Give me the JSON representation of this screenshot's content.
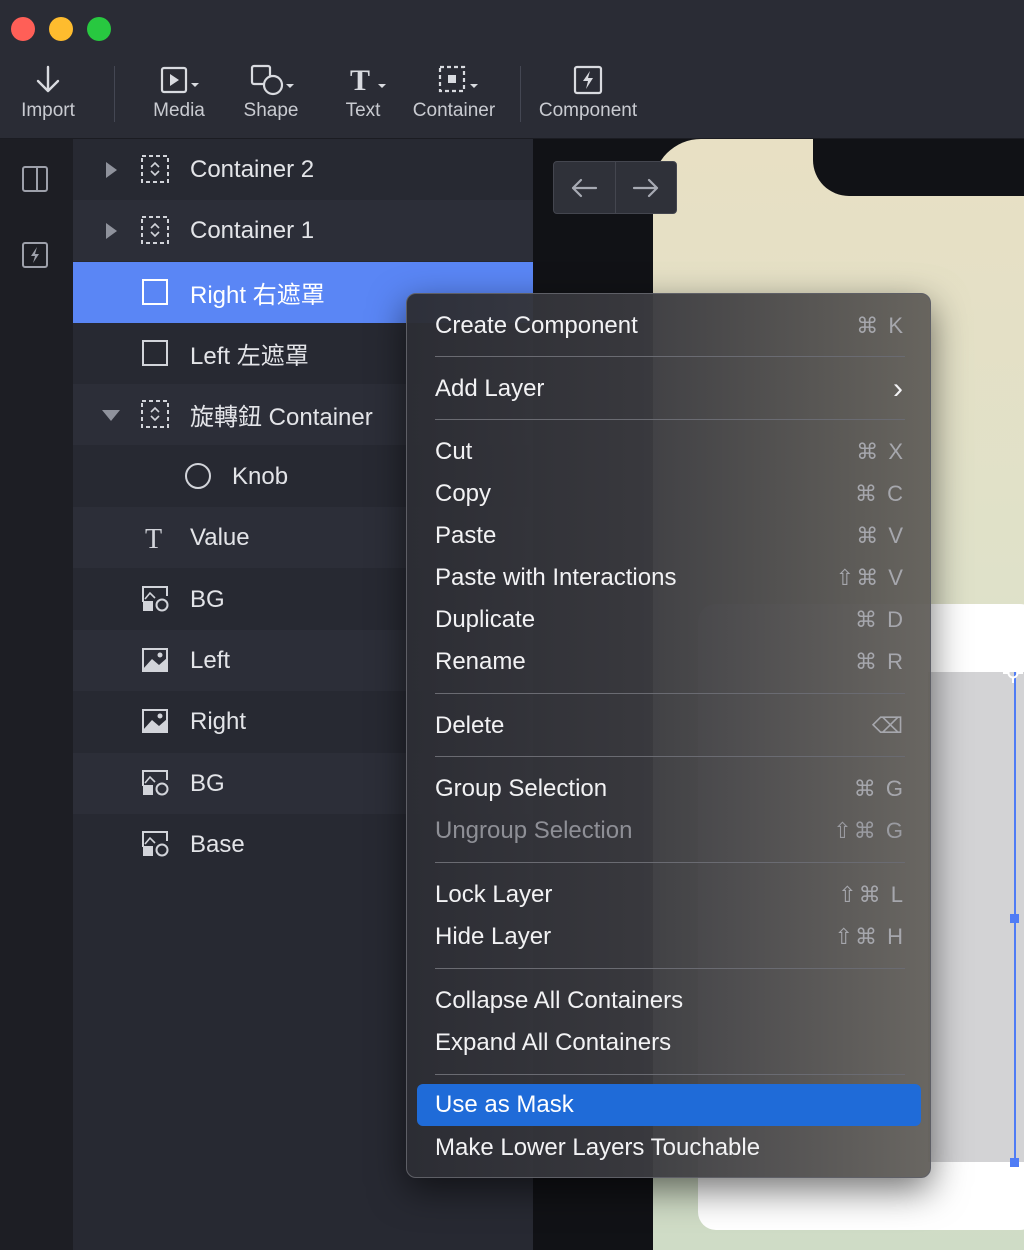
{
  "toolbar": {
    "import": "Import",
    "media": "Media",
    "shape": "Shape",
    "text": "Text",
    "container": "Container",
    "component": "Component"
  },
  "layers": [
    {
      "label": "Container 2",
      "icon": "container-icon",
      "expander": "collapsed"
    },
    {
      "label": "Container 1",
      "icon": "container-icon",
      "expander": "collapsed"
    },
    {
      "label": "Right 右遮罩",
      "icon": "rectangle-icon",
      "selected": true
    },
    {
      "label": "Left 左遮罩",
      "icon": "rectangle-icon"
    },
    {
      "label": "旋轉鈕 Container",
      "icon": "container-icon",
      "expander": "expanded"
    },
    {
      "label": "Knob",
      "icon": "circle-icon"
    },
    {
      "label": "Value",
      "icon": "text-icon"
    },
    {
      "label": "BG",
      "icon": "image-shape-icon"
    },
    {
      "label": "Left",
      "icon": "image-icon"
    },
    {
      "label": "Right",
      "icon": "image-icon"
    },
    {
      "label": "BG",
      "icon": "image-shape-icon"
    },
    {
      "label": "Base",
      "icon": "image-shape-icon"
    }
  ],
  "menu": {
    "create_component": {
      "label": "Create Component",
      "shortcut": "⌘ K"
    },
    "add_layer": {
      "label": "Add Layer",
      "shortcut": "›"
    },
    "cut": {
      "label": "Cut",
      "shortcut": "⌘ X"
    },
    "copy": {
      "label": "Copy",
      "shortcut": "⌘ C"
    },
    "paste": {
      "label": "Paste",
      "shortcut": "⌘ V"
    },
    "paste_interactions": {
      "label": "Paste with Interactions",
      "shortcut": "⇧⌘ V"
    },
    "duplicate": {
      "label": "Duplicate",
      "shortcut": "⌘ D"
    },
    "rename": {
      "label": "Rename",
      "shortcut": "⌘ R"
    },
    "delete": {
      "label": "Delete",
      "shortcut": "⌫"
    },
    "group": {
      "label": "Group Selection",
      "shortcut": "⌘ G"
    },
    "ungroup": {
      "label": "Ungroup Selection",
      "shortcut": "⇧⌘ G"
    },
    "lock": {
      "label": "Lock Layer",
      "shortcut": "⇧⌘ L"
    },
    "hide": {
      "label": "Hide Layer",
      "shortcut": "⇧⌘ H"
    },
    "collapse_all": {
      "label": "Collapse All Containers"
    },
    "expand_all": {
      "label": "Expand All Containers"
    },
    "use_as_mask": {
      "label": "Use as Mask"
    },
    "make_touchable": {
      "label": "Make Lower Layers Touchable"
    }
  },
  "colors": {
    "selection": "#5a86f5",
    "menu_highlight": "#1f6bd8",
    "accent_line": "#4f7cf5"
  }
}
